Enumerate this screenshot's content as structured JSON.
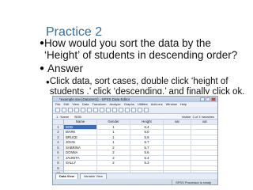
{
  "slide": {
    "title": "Practice 2",
    "question": "How would you sort the data by the ‘Height’ of students in descending order?",
    "answer_label": "Answer",
    "instruction": "Click data, sort cases, double click ‘height of students ,’ click ‘descending,’ and finally click ok."
  },
  "spss": {
    "window_title": "*example.sav [DataSet1] - SPSS Data Editor",
    "menu": [
      "File",
      "Edit",
      "View",
      "Data",
      "Transform",
      "Analyze",
      "Graphs",
      "Utilities",
      "Add-ons",
      "Window",
      "Help"
    ],
    "cell_ref": "1 : Name",
    "cell_value": "BOB",
    "visible_label": "Visible: 3 of 3 Variables",
    "columns": [
      "",
      "Name",
      "Gender",
      "Height",
      "var",
      "var"
    ],
    "rows": [
      {
        "n": "1",
        "name": "BOB",
        "gender": "1",
        "height": "6.4"
      },
      {
        "n": "2",
        "name": "MARK",
        "gender": "1",
        "height": "6.0"
      },
      {
        "n": "3",
        "name": "BRUCE",
        "gender": "1",
        "height": "5.9"
      },
      {
        "n": "4",
        "name": "JOHN",
        "gender": "1",
        "height": "5.7"
      },
      {
        "n": "5",
        "name": "SABRINA",
        "gender": "2",
        "height": "5.7"
      },
      {
        "n": "6",
        "name": "DONNA",
        "gender": "2",
        "height": "5.6"
      },
      {
        "n": "7",
        "name": "JAUNITA",
        "gender": "2",
        "height": "5.4"
      },
      {
        "n": "8",
        "name": "SALLY",
        "gender": "2",
        "height": "5.3"
      },
      {
        "n": "9",
        "name": "",
        "gender": "",
        "height": ""
      },
      {
        "n": "10",
        "name": "",
        "gender": "",
        "height": ""
      }
    ],
    "tabs": [
      "Data View",
      "Variable View"
    ],
    "status": "SPSS Processor is ready"
  }
}
